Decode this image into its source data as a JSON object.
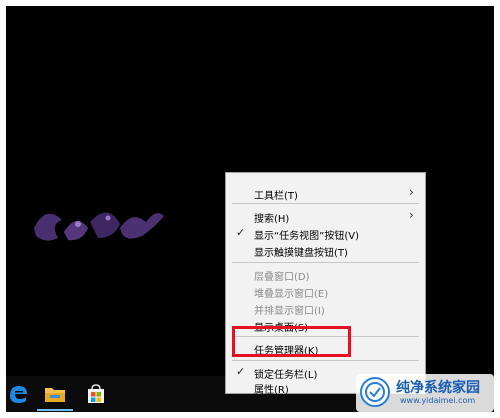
{
  "context_menu": {
    "toolbars": "工具栏(T)",
    "search": "搜索(H)",
    "show_task_view": "显示“任务视图”按钮(V)",
    "show_touch_keyboard": "显示触摸键盘按钮(T)",
    "cascade": "层叠窗口(D)",
    "stacked": "堆叠显示窗口(E)",
    "side_by_side": "并排显示窗口(I)",
    "show_desktop": "显示桌面(S)",
    "task_manager": "任务管理器(K)",
    "lock_taskbar": "锁定任务栏(L)",
    "properties": "属性(R)"
  },
  "icons": {
    "submenu": "chevron-right-icon",
    "checked": "checkmark-icon",
    "edge": "edge-icon",
    "explorer": "file-explorer-icon",
    "store": "store-icon"
  },
  "watermark": {
    "title": "纯净系统家园",
    "url": "www.yidaimei.com"
  },
  "colors": {
    "desktop": "#000000",
    "menu_bg": "#f2f2f2",
    "highlight": "#e81123",
    "disabled_text": "#8a8a8a"
  }
}
